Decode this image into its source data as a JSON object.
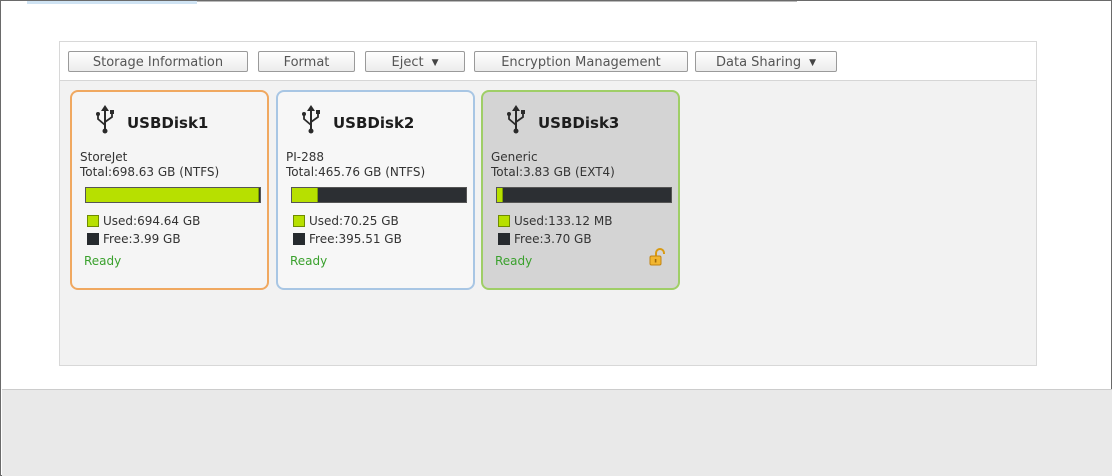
{
  "toolbar": {
    "storage_info": "Storage Information",
    "format": "Format",
    "eject": "Eject",
    "encryption": "Encryption Management",
    "data_sharing": "Data Sharing"
  },
  "icons": {
    "dropdown": "chevron-down-icon",
    "usb": "usb-icon",
    "lock": "unlock-icon"
  },
  "colors": {
    "used": "#b7e000",
    "free": "#262a2e",
    "ready": "#3aa12d",
    "selected_border": "#f0a860",
    "hover_border": "#a8c6e4",
    "active_border": "#9fce67"
  },
  "disks": [
    {
      "name": "USBDisk1",
      "vendor": "StoreJet",
      "total": "Total:698.63 GB (NTFS)",
      "used": "Used:694.64 GB",
      "free": "Free:3.99 GB",
      "used_fraction": 0.994,
      "status": "Ready"
    },
    {
      "name": "USBDisk2",
      "vendor": "PI-288",
      "total": "Total:465.76 GB (NTFS)",
      "used": "Used:70.25 GB",
      "free": "Free:395.51 GB",
      "used_fraction": 0.151,
      "status": "Ready"
    },
    {
      "name": "USBDisk3",
      "vendor": "Generic",
      "total": "Total:3.83 GB (EXT4)",
      "used": "Used:133.12 MB",
      "free": "Free:3.70 GB",
      "used_fraction": 0.034,
      "status": "Ready"
    }
  ]
}
